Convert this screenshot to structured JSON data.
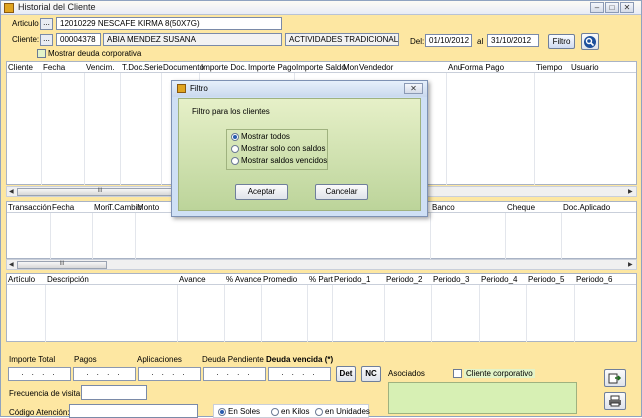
{
  "window": {
    "title": "Historial del Cliente"
  },
  "header": {
    "articulo_label": "Articulo",
    "articulo_value": "12010229 NESCAFE KIRMA 8(50X7G)",
    "cliente_label": "Cliente:",
    "cliente_code": "00004378",
    "cliente_name": "ABIA MENDEZ SUSANA",
    "actividad": "ACTIVIDADES TRADICIONALES",
    "del_label": "Del:",
    "del_value": "01/10/2012",
    "al_label": "al",
    "al_value": "31/10/2012",
    "filtro_button": "Filtro",
    "browse_dots": "...",
    "deuda_corporativa": "Mostrar deuda corporativa"
  },
  "grid1": {
    "columns": [
      "Cliente",
      "Fecha",
      "Vencim.",
      "T.Doc.",
      "Serie",
      "Documento",
      "Importe Doc.",
      "Importe Pago",
      "Importe Saldo",
      "Mon",
      "Vendedor",
      "Anu",
      "Forma Pago",
      "Tiempo",
      "Usuario"
    ]
  },
  "grid2": {
    "columns": [
      "Transacción",
      "Fecha",
      "Mon",
      "T.Cambio",
      "Monto",
      "Banco",
      "Cheque",
      "Doc.Aplicado"
    ]
  },
  "grid3": {
    "columns": [
      "Artículo",
      "Descripción",
      "Avance",
      "% Avance",
      "Promedio",
      "% Part",
      "Periodo_1",
      "Periodo_2",
      "Periodo_3",
      "Periodo_4",
      "Periodo_5",
      "Periodo_6"
    ]
  },
  "scroll_grip": "III",
  "footer": {
    "importe_total": "Importe Total",
    "pagos": "Pagos",
    "aplicaciones": "Aplicaciones",
    "deuda_pendiente": "Deuda Pendiente",
    "deuda_vencida": "Deuda vencida (*)",
    "empty_amount": ". . . .",
    "det_button": "Det",
    "nc_button": "NC",
    "asociados": "Asociados",
    "cliente_corporativo": "Cliente corporativo",
    "frecuencia": "Frecuencia de visita",
    "codigo_atencion": "Código Atención:",
    "units": [
      "En Soles",
      "en Kilos",
      "en Unidades"
    ],
    "selected_unit": "En Soles"
  },
  "dialog": {
    "title": "Filtro",
    "subtitle": "Filtro para los clientes",
    "options": [
      "Mostrar todos",
      "Mostrar solo con saldos",
      "Mostrar saldos vencidos"
    ],
    "selected": "Mostrar todos",
    "accept": "Aceptar",
    "cancel": "Cancelar"
  }
}
